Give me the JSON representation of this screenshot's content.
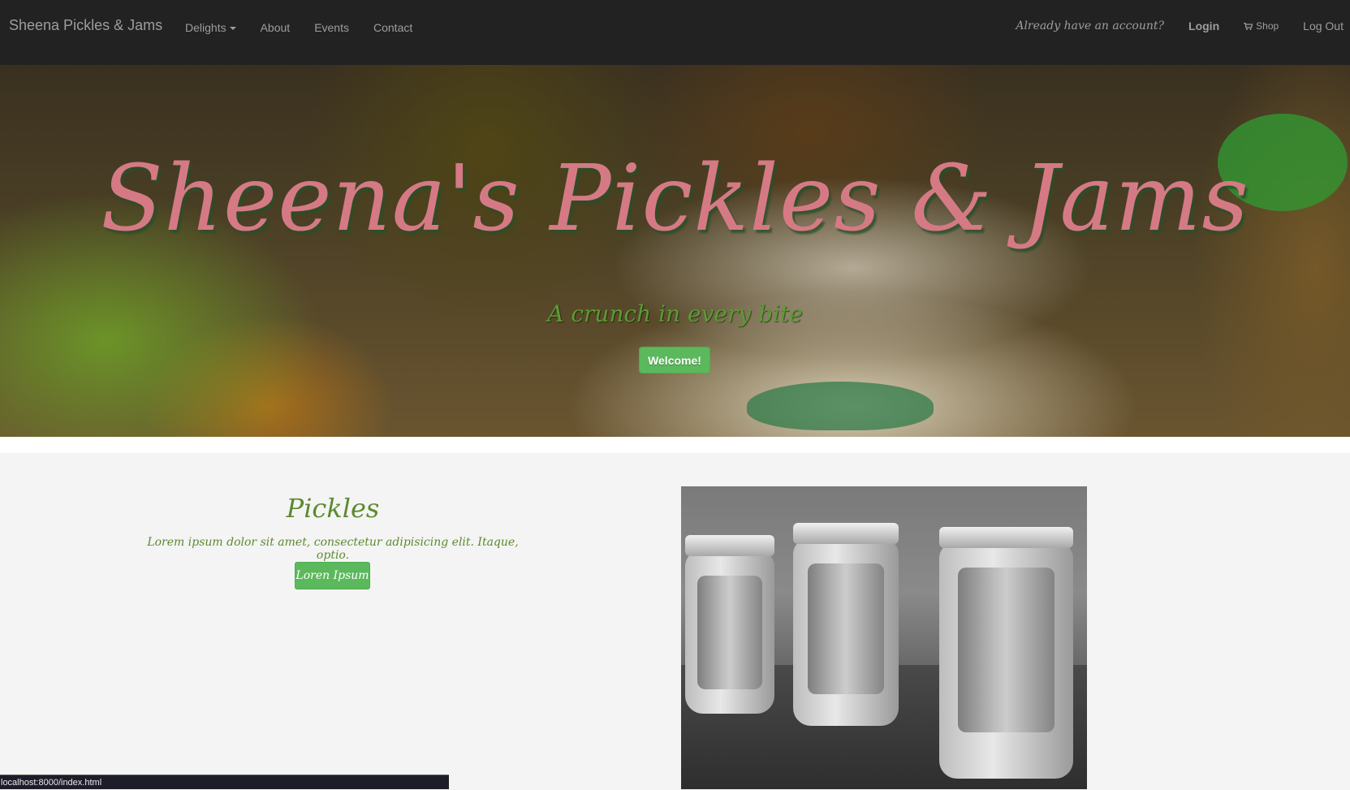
{
  "navbar": {
    "brand": "Sheena Pickles & Jams",
    "links": [
      "Delights",
      "About",
      "Events",
      "Contact"
    ],
    "account_prompt": "Already have an account?",
    "login": "Login",
    "shop": "Shop",
    "logout": "Log Out"
  },
  "hero": {
    "title": "Sheena's Pickles & Jams",
    "subtitle": "A crunch in every bite",
    "button": "Welcome!"
  },
  "feature": {
    "title": "Pickles",
    "description": "Lorem ipsum dolor sit amet, consectetur adipisicing elit. Itaque, optio.",
    "button": "Loren Ipsum"
  },
  "status_bar": {
    "url": "localhost:8000/index.html"
  },
  "colors": {
    "navbar_bg": "#222222",
    "nav_text": "#9d9d9d",
    "title_pink": "#d57a85",
    "accent_green": "#5cb85c",
    "text_green": "#5b8a2e"
  },
  "icons": {
    "shop": "shopping-cart-icon",
    "dropdown": "caret-down-icon"
  }
}
